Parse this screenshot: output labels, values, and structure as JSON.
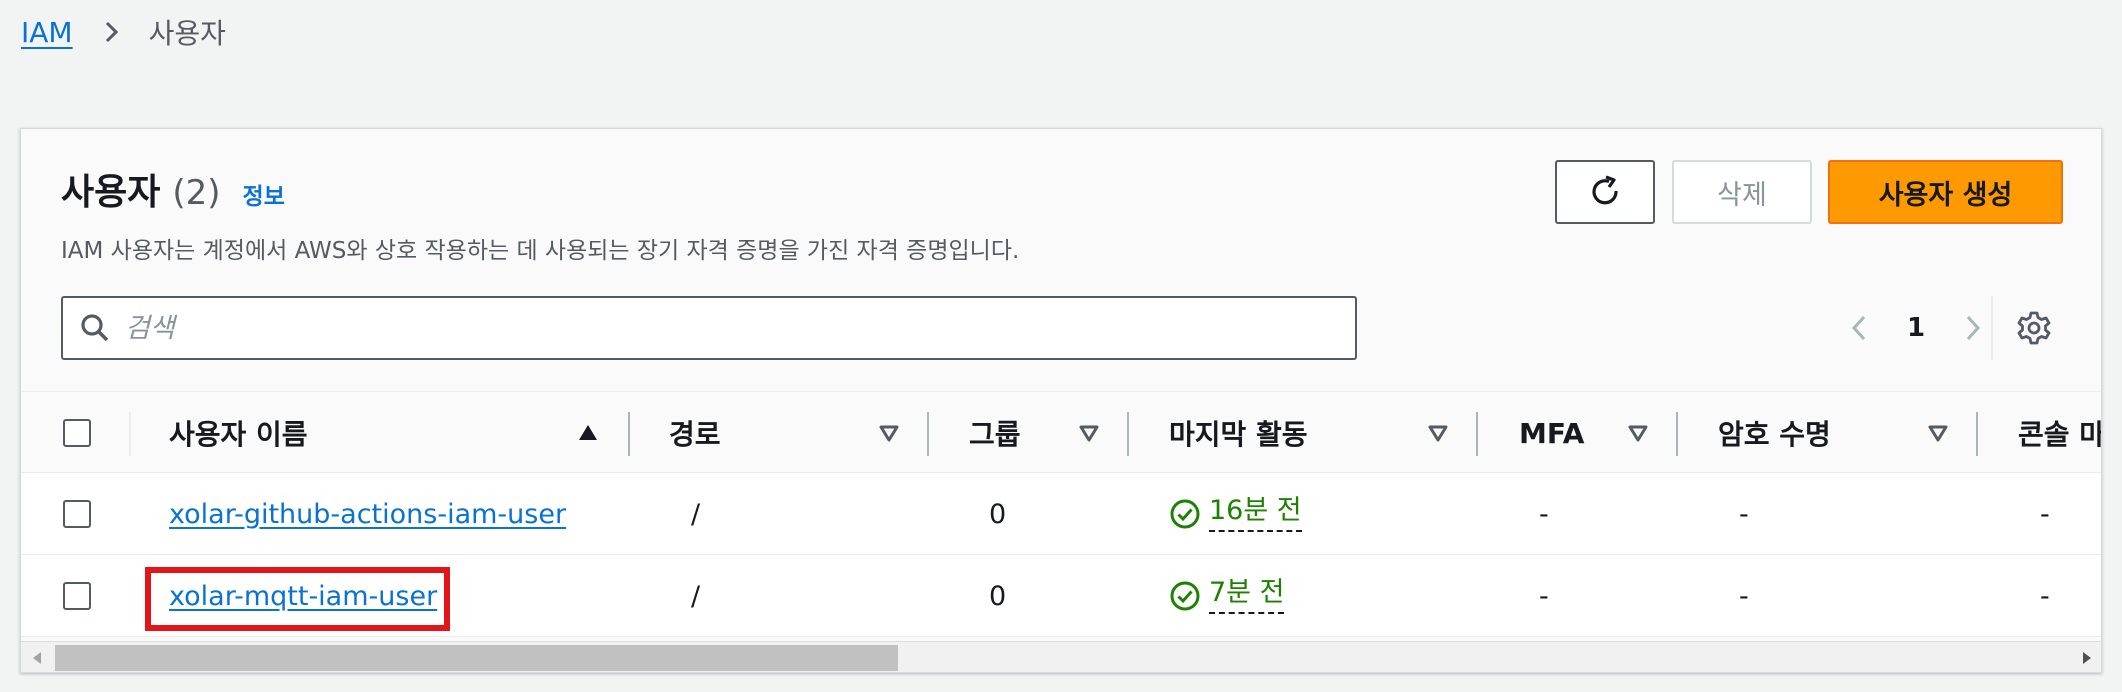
{
  "breadcrumb": {
    "root": "IAM",
    "current": "사용자"
  },
  "header": {
    "title": "사용자",
    "count": "(2)",
    "info": "정보",
    "description": "IAM 사용자는 계정에서 AWS와 상호 작용하는 데 사용되는 장기 자격 증명을 가진 자격 증명입니다."
  },
  "actions": {
    "delete": "삭제",
    "create": "사용자 생성"
  },
  "search": {
    "placeholder": "검색",
    "value": ""
  },
  "pagination": {
    "page": "1"
  },
  "columns": {
    "username": "사용자 이름",
    "path": "경로",
    "groups": "그룹",
    "last_activity": "마지막 활동",
    "mfa": "MFA",
    "password_age": "암호 수명",
    "console": "콘솔 마"
  },
  "rows": [
    {
      "username": "xolar-github-actions-iam-user",
      "path": "/",
      "groups": "0",
      "last_activity": "16분 전",
      "mfa": "-",
      "password_age": "-",
      "console": "-"
    },
    {
      "username": "xolar-mqtt-iam-user",
      "path": "/",
      "groups": "0",
      "last_activity": "7분 전",
      "mfa": "-",
      "password_age": "-",
      "console": "-"
    }
  ],
  "colors": {
    "link": "#0972d3",
    "primary": "#ff9900",
    "success": "#1d8102",
    "highlight": "#e0161b"
  },
  "icons": [
    "chevron-right-icon",
    "refresh-icon",
    "search-icon",
    "chevron-left-icon",
    "settings-gear-icon",
    "sort-ascending-icon",
    "sort-icon",
    "status-success-icon"
  ]
}
